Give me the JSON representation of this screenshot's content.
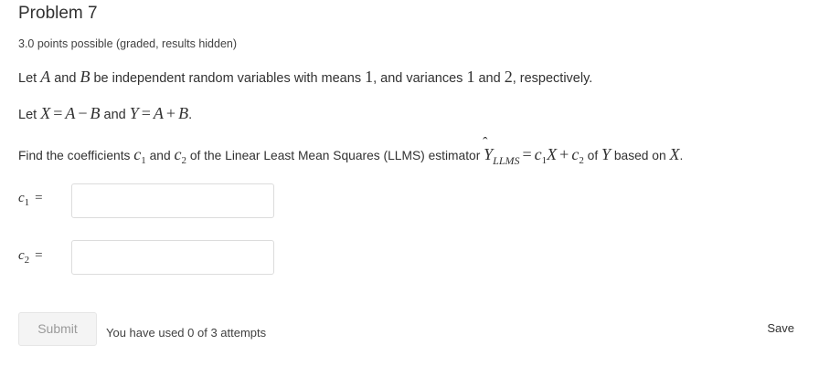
{
  "problem": {
    "title": "Problem 7",
    "points_text": "3.0 points possible (graded, results hidden)"
  },
  "statement": {
    "l1_a": "Let ",
    "l1_A": "A",
    "l1_b": " and ",
    "l1_B": "B",
    "l1_c": " be independent random variables with means ",
    "l1_mean": "1",
    "l1_d": ", and variances ",
    "l1_var1": "1",
    "l1_e": " and ",
    "l1_var2": "2",
    "l1_f": ", respectively.",
    "l2_a": "Let ",
    "l2_X": "X",
    "l2_eq1": "=",
    "l2_A": "A",
    "l2_minus": "−",
    "l2_B": "B",
    "l2_and": " and ",
    "l2_Y": "Y",
    "l2_eq2": "=",
    "l2_A2": "A",
    "l2_plus": "+",
    "l2_B2": "B",
    "l2_dot": ".",
    "l3_a": "Find the coefficients ",
    "l3_c1": "c",
    "l3_c1sub": "1",
    "l3_b": " and ",
    "l3_c2": "c",
    "l3_c2sub": "2",
    "l3_c": " of the Linear Least Mean Squares (LLMS) estimator ",
    "l3_Yhat": "Y",
    "l3_hat": "ˆ",
    "l3_llms": "LLMS",
    "l3_eq": "=",
    "l3_c1b": "c",
    "l3_c1bsub": "1",
    "l3_X": "X",
    "l3_plus": "+",
    "l3_c2b": "c",
    "l3_c2bsub": "2",
    "l3_d": " of ",
    "l3_Y": "Y",
    "l3_e": " based on ",
    "l3_X2": "X",
    "l3_dot": "."
  },
  "fields": [
    {
      "var": "c",
      "sub": "1",
      "eq": "=",
      "value": "",
      "placeholder": ""
    },
    {
      "var": "c",
      "sub": "2",
      "eq": "=",
      "value": "",
      "placeholder": ""
    }
  ],
  "actions": {
    "submit_label": "Submit",
    "attempts_text": "You have used 0 of 3 attempts",
    "save_label": "Save"
  }
}
